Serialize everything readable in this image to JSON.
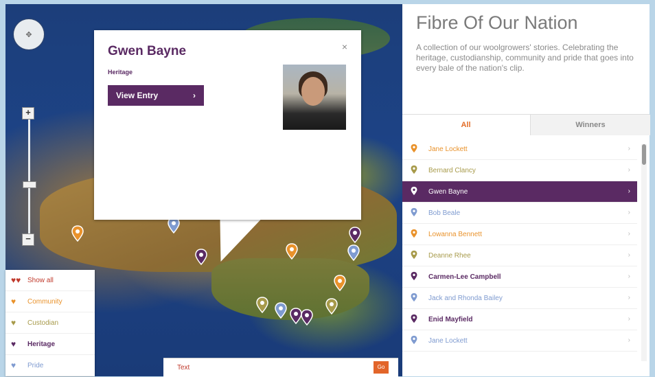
{
  "popup": {
    "name": "Gwen Bayne",
    "category": "Heritage",
    "view_button": "View Entry",
    "view_chevron": "›",
    "close": "×"
  },
  "map_controls": {
    "zoom_in": "+",
    "zoom_out": "−"
  },
  "legend": {
    "items": [
      {
        "label": "Show all",
        "color": "#c0392b"
      },
      {
        "label": "Community",
        "color": "#e9922b"
      },
      {
        "label": "Custodian",
        "color": "#a79a4a"
      },
      {
        "label": "Heritage",
        "color": "#5a2a63"
      },
      {
        "label": "Pride",
        "color": "#7f9bd0"
      }
    ]
  },
  "search": {
    "text": "Text",
    "go": "Go"
  },
  "panel": {
    "title": "Fibre Of Our Nation",
    "description": "A collection of our woolgrowers' stories. Celebrating the heritage, custodianship, community and pride that goes into every bale of the nation's clip.",
    "tabs": [
      "All",
      "Winners"
    ]
  },
  "entries": [
    {
      "name": "Jane Lockett",
      "color": "#e9922b",
      "active": false
    },
    {
      "name": "Bernard Clancy",
      "color": "#a79a4a",
      "active": false
    },
    {
      "name": "Gwen Bayne",
      "color": "#ffffff",
      "active": true
    },
    {
      "name": "Bob Beale",
      "color": "#7f9bd0",
      "active": false
    },
    {
      "name": "Lowanna Bennett",
      "color": "#e9922b",
      "active": false
    },
    {
      "name": "Deanne Rhee",
      "color": "#a79a4a",
      "active": false
    },
    {
      "name": "Carmen-Lee Campbell",
      "color": "#5a2a63",
      "active": false
    },
    {
      "name": "Jack and Rhonda Bailey",
      "color": "#7f9bd0",
      "active": false
    },
    {
      "name": "Enid Mayfield",
      "color": "#5a2a63",
      "active": false
    },
    {
      "name": "Jane Lockett",
      "color": "#7f9bd0",
      "active": false
    }
  ],
  "chevron": "›"
}
